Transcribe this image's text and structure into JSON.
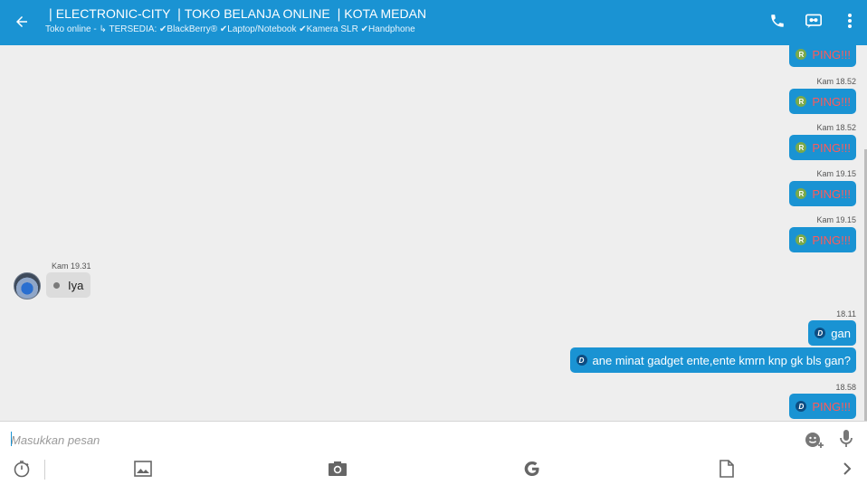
{
  "header": {
    "title": "❘ELECTRONIC-CITY ❘TOKO BELANJA ONLINE ❘KOTA MEDAN",
    "subtitle": "Toko online - ↳ TERSEDIA: ✔BlackBerry® ✔Laptop/Notebook ✔Kamera SLR ✔Handphone",
    "back_icon": "arrow-left-icon",
    "actions": [
      "phone-icon",
      "video-icon",
      "more-vert-icon"
    ]
  },
  "messages": [
    {
      "side": "out",
      "badge": "R",
      "text": "PING!!!",
      "time": ""
    },
    {
      "side": "out",
      "badge": "R",
      "text": "PING!!!",
      "time": "Kam 18.52"
    },
    {
      "side": "out",
      "badge": "R",
      "text": "PING!!!",
      "time": "Kam 18.52"
    },
    {
      "side": "out",
      "badge": "R",
      "text": "PING!!!",
      "time": "Kam 19.15"
    },
    {
      "side": "out",
      "badge": "R",
      "text": "PING!!!",
      "time": "Kam 19.15"
    },
    {
      "side": "in",
      "text": "Iya",
      "time": "Kam 19.31"
    },
    {
      "side": "out",
      "badge": "D",
      "text": "gan",
      "time": "18.11"
    },
    {
      "side": "out",
      "badge": "D",
      "text": "ane minat gadget ente,ente kmrn knp gk bls gan?",
      "time": ""
    },
    {
      "side": "out",
      "badge": "D",
      "text": "PING!!!",
      "time": "18.58"
    }
  ],
  "composer": {
    "placeholder": "Masukkan pesan",
    "value": ""
  },
  "toolbar": [
    "timer-icon",
    "image-icon",
    "camera-icon",
    "google-icon",
    "file-icon",
    "chevron-right-icon"
  ],
  "colors": {
    "accent": "#1a93d3",
    "ping": "#ff5a5a",
    "background": "#eeeeee",
    "incoming_bubble": "#dcdcdc"
  }
}
